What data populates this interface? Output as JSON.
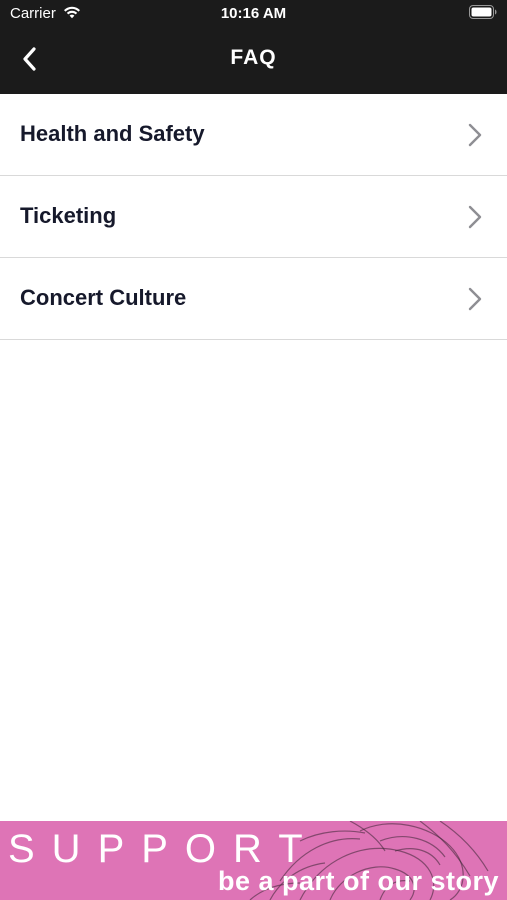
{
  "status_bar": {
    "carrier": "Carrier",
    "time": "10:16 AM",
    "wifi_icon": "wifi-icon",
    "battery_icon": "battery-icon"
  },
  "nav": {
    "back_icon": "chevron-left-icon",
    "title": "FAQ"
  },
  "faq_items": [
    {
      "label": "Health and Safety",
      "icon": "chevron-right-icon"
    },
    {
      "label": "Ticketing",
      "icon": "chevron-right-icon"
    },
    {
      "label": "Concert Culture",
      "icon": "chevron-right-icon"
    }
  ],
  "banner": {
    "title": "SUPPORT",
    "subtitle": "be a part of our story",
    "background_color": "#de74b6"
  },
  "colors": {
    "header_bg": "#1b1b1b",
    "list_text": "#16192b",
    "chevron": "#8e8e93",
    "divider": "#d9d9d9"
  }
}
